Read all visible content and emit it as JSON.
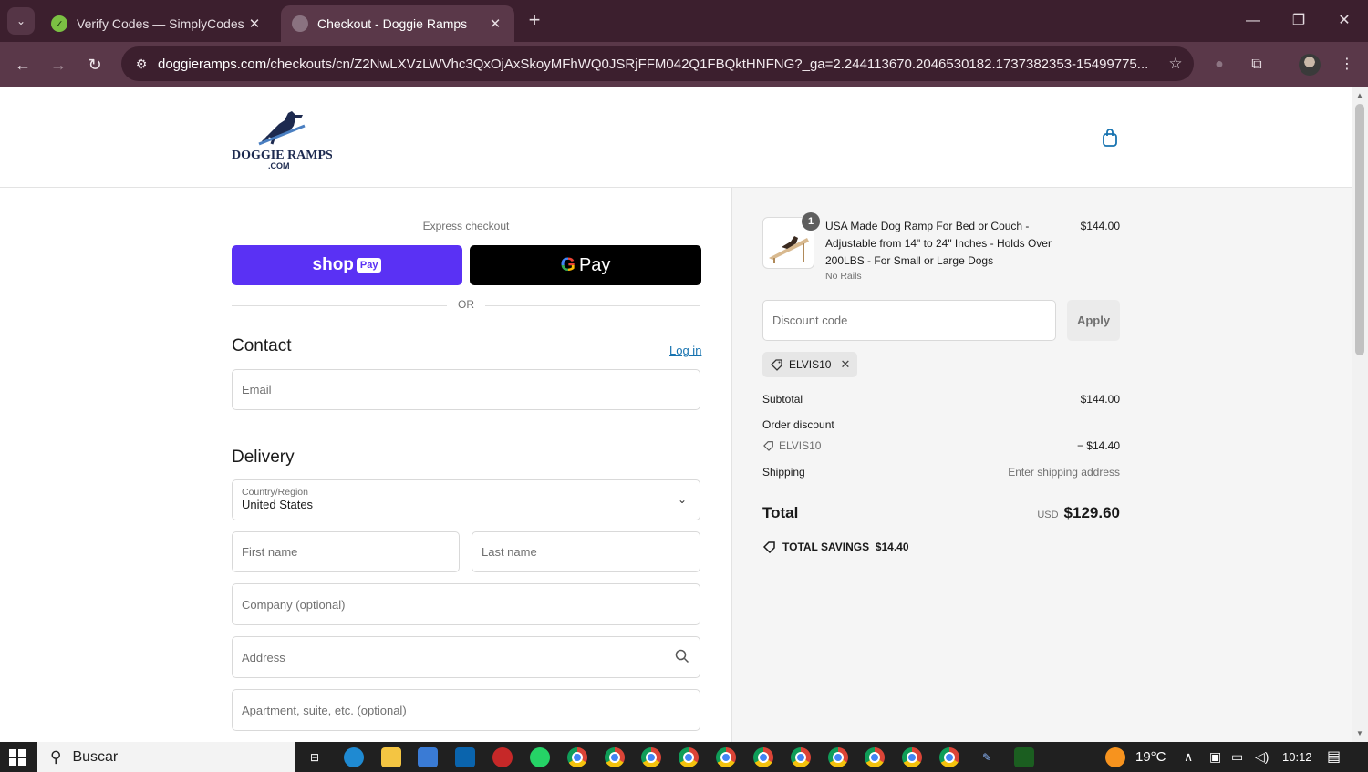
{
  "browser": {
    "tabs": [
      {
        "title": "Verify Codes — SimplyCodes",
        "active": false,
        "close": "✕"
      },
      {
        "title": "Checkout - Doggie Ramps",
        "active": true,
        "close": "✕"
      }
    ],
    "new_tab": "+",
    "url_host": "doggieramps.com",
    "url_path": "/checkouts/cn/Z2NwLXVzLWVhc3QxOjAxSkoyMFhWQ0JSRjFFM042Q1FBQktHNFNG?_ga=2.244113670.2046530182.1737382353-15499775..."
  },
  "header": {
    "logo_text": "DOGGIE RAMPS",
    "logo_sub": ".COM"
  },
  "checkout": {
    "express_label": "Express checkout",
    "shop_pay_label": "shop",
    "shop_pay_badge": "Pay",
    "gpay_label": "Pay",
    "gpay_g": "G",
    "or_label": "OR",
    "contact_title": "Contact",
    "login_link": "Log in",
    "email_placeholder": "Email",
    "delivery_title": "Delivery",
    "country_label": "Country/Region",
    "country_value": "United States",
    "first_name_placeholder": "First name",
    "last_name_placeholder": "Last name",
    "company_placeholder": "Company (optional)",
    "address_placeholder": "Address",
    "apartment_placeholder": "Apartment, suite, etc. (optional)"
  },
  "summary": {
    "product": {
      "quantity": "1",
      "title": "USA Made Dog Ramp For Bed or Couch - Adjustable from 14\" to 24\" Inches - Holds Over 200LBS - For Small or Large Dogs",
      "variant": "No Rails",
      "price": "$144.00"
    },
    "discount_placeholder": "Discount code",
    "apply_label": "Apply",
    "applied_code": "ELVIS10",
    "subtotal_label": "Subtotal",
    "subtotal_value": "$144.00",
    "order_discount_label": "Order discount",
    "discount_code_line": "ELVIS10",
    "discount_amount": "− $14.40",
    "shipping_label": "Shipping",
    "shipping_value": "Enter shipping address",
    "total_label": "Total",
    "total_currency": "USD",
    "total_value": "$129.60",
    "savings_label": "TOTAL SAVINGS",
    "savings_value": "$14.40"
  },
  "taskbar": {
    "search_label": "Buscar",
    "temperature": "19°C",
    "time": "10:12"
  },
  "colors": {
    "shop_pay": "#5a31f4",
    "link": "#1773b0",
    "chrome_frame": "#3c1f2e"
  }
}
